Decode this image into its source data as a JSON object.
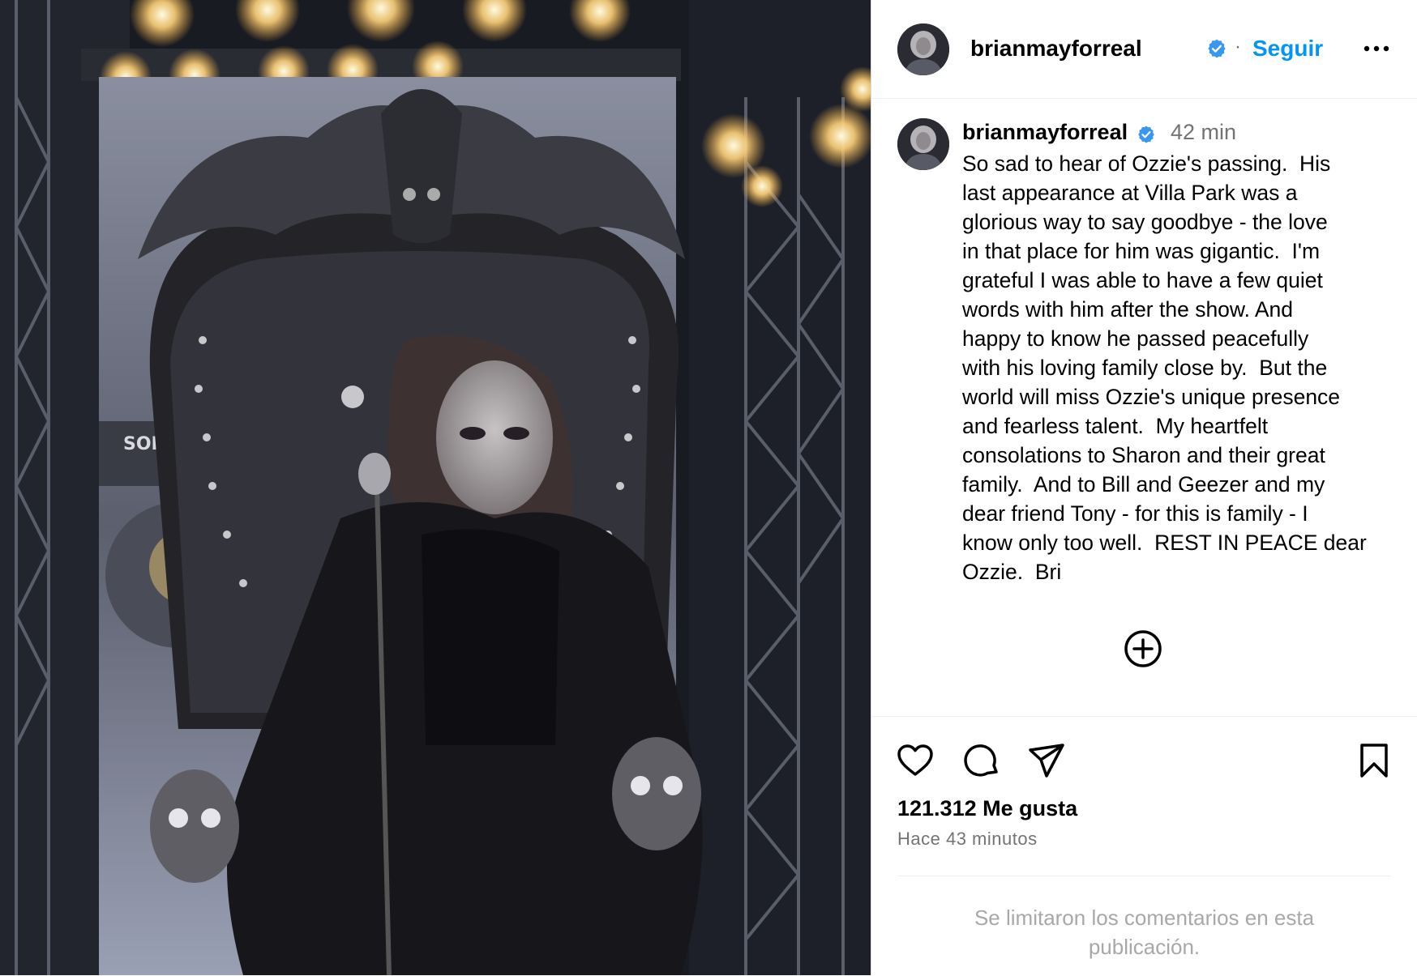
{
  "post": {
    "username": "brianmayforreal",
    "follow_label": "Seguir",
    "separator": "·",
    "caption": {
      "username": "brianmayforreal",
      "time": "42 min",
      "text": "So sad to hear of Ozzie's passing.  His\nlast appearance at Villa Park was a\nglorious way to say goodbye - the love\nin that place for him was gigantic.  I'm\ngrateful I was able to have a few quiet\nwords with him after the show. And\nhappy to know he passed peacefully\nwith his loving family close by.  But the\nworld will miss Ozzie's unique presence\nand fearless talent.  My heartfelt\nconsolations to Sharon and their great\nfamily.  And to Bill and Geezer and my\ndear friend Tony - for this is family - I\nknow only too well.  REST IN PEACE dear\nOzzie.  Bri"
    },
    "likes": "121.312 Me gusta",
    "time_ago": "Hace 43 minutos",
    "comments_limited": "Se limitaron los comentarios en esta publicación.",
    "photo_sign_text": "SONOR"
  },
  "icons": {
    "verified": "verified-badge-icon",
    "more": "more-options-icon",
    "load_more": "plus-circle-icon",
    "like": "heart-icon",
    "comment": "comment-icon",
    "share": "share-icon",
    "save": "bookmark-icon"
  },
  "colors": {
    "follow_blue": "#0095f6",
    "verified_blue": "#3897f0",
    "secondary_text": "#737373",
    "disabled_text": "#a8a8a8"
  }
}
